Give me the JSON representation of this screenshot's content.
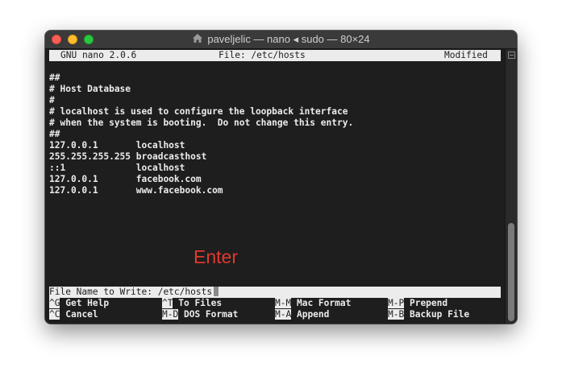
{
  "window": {
    "title": "paveljelic — nano ◂ sudo — 80×24"
  },
  "header": {
    "version": "GNU nano 2.0.6",
    "file": "File: /etc/hosts",
    "status": "Modified"
  },
  "file_lines": [
    "##",
    "# Host Database",
    "#",
    "# localhost is used to configure the loopback interface",
    "# when the system is booting.  Do not change this entry.",
    "##",
    "127.0.0.1       localhost",
    "255.255.255.255 broadcasthost",
    "::1             localhost",
    "127.0.0.1       facebook.com",
    "127.0.0.1       www.facebook.com"
  ],
  "prompt": {
    "text": "File Name to Write: /etc/hosts"
  },
  "annotation": "Enter",
  "shortcuts": [
    {
      "key": "^G",
      "label": "Get Help"
    },
    {
      "key": "^T",
      "label": "To Files"
    },
    {
      "key": "M-M",
      "label": "Mac Format"
    },
    {
      "key": "M-P",
      "label": "Prepend"
    },
    {
      "key": "^C",
      "label": "Cancel"
    },
    {
      "key": "M-D",
      "label": "DOS Format"
    },
    {
      "key": "M-A",
      "label": "Append"
    },
    {
      "key": "M-B",
      "label": "Backup File"
    }
  ],
  "colors": {
    "annotation": "#e0392e",
    "close": "#fd5f57",
    "minimize": "#febc2e",
    "maximize": "#28c840"
  }
}
